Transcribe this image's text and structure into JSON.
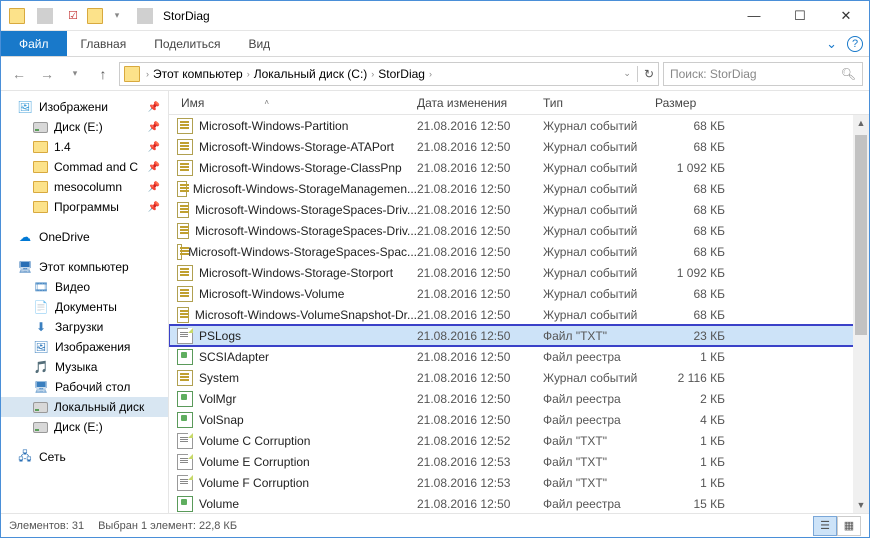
{
  "window": {
    "title": "StorDiag"
  },
  "ribbon": {
    "file": "Файл",
    "tabs": [
      "Главная",
      "Поделиться",
      "Вид"
    ]
  },
  "breadcrumb": {
    "crumbs": [
      "Этот компьютер",
      "Локальный диск (C:)",
      "StorDiag"
    ]
  },
  "search": {
    "placeholder": "Поиск: StorDiag"
  },
  "columns": {
    "name": "Имя",
    "date": "Дата изменения",
    "type": "Тип",
    "size": "Размер"
  },
  "sidebar": {
    "quickaccess_label": "Изображени",
    "pinned": [
      {
        "label": "Диск (E:)",
        "icon": "drive"
      },
      {
        "label": "1.4",
        "icon": "folder"
      },
      {
        "label": "Commad and C",
        "icon": "folder"
      },
      {
        "label": "mesocolumn",
        "icon": "folder"
      },
      {
        "label": "Программы",
        "icon": "folder"
      }
    ],
    "onedrive": "OneDrive",
    "thispc": "Этот компьютер",
    "thispc_items": [
      {
        "label": "Видео"
      },
      {
        "label": "Документы"
      },
      {
        "label": "Загрузки"
      },
      {
        "label": "Изображения"
      },
      {
        "label": "Музыка"
      },
      {
        "label": "Рабочий стол"
      },
      {
        "label": "Локальный диск",
        "selected": true,
        "icon": "drive"
      },
      {
        "label": "Диск (E:)",
        "icon": "drive"
      }
    ],
    "network": "Сеть"
  },
  "files": [
    {
      "name": "Microsoft-Windows-Partition",
      "date": "21.08.2016 12:50",
      "type": "Журнал событий",
      "size": "68 КБ",
      "icon": "evt"
    },
    {
      "name": "Microsoft-Windows-Storage-ATAPort",
      "date": "21.08.2016 12:50",
      "type": "Журнал событий",
      "size": "68 КБ",
      "icon": "evt"
    },
    {
      "name": "Microsoft-Windows-Storage-ClassPnp",
      "date": "21.08.2016 12:50",
      "type": "Журнал событий",
      "size": "1 092 КБ",
      "icon": "evt"
    },
    {
      "name": "Microsoft-Windows-StorageManagemen...",
      "date": "21.08.2016 12:50",
      "type": "Журнал событий",
      "size": "68 КБ",
      "icon": "evt"
    },
    {
      "name": "Microsoft-Windows-StorageSpaces-Driv...",
      "date": "21.08.2016 12:50",
      "type": "Журнал событий",
      "size": "68 КБ",
      "icon": "evt"
    },
    {
      "name": "Microsoft-Windows-StorageSpaces-Driv...",
      "date": "21.08.2016 12:50",
      "type": "Журнал событий",
      "size": "68 КБ",
      "icon": "evt"
    },
    {
      "name": "Microsoft-Windows-StorageSpaces-Spac...",
      "date": "21.08.2016 12:50",
      "type": "Журнал событий",
      "size": "68 КБ",
      "icon": "evt"
    },
    {
      "name": "Microsoft-Windows-Storage-Storport",
      "date": "21.08.2016 12:50",
      "type": "Журнал событий",
      "size": "1 092 КБ",
      "icon": "evt"
    },
    {
      "name": "Microsoft-Windows-Volume",
      "date": "21.08.2016 12:50",
      "type": "Журнал событий",
      "size": "68 КБ",
      "icon": "evt"
    },
    {
      "name": "Microsoft-Windows-VolumeSnapshot-Dr...",
      "date": "21.08.2016 12:50",
      "type": "Журнал событий",
      "size": "68 КБ",
      "icon": "evt"
    },
    {
      "name": "PSLogs",
      "date": "21.08.2016 12:50",
      "type": "Файл \"TXT\"",
      "size": "23 КБ",
      "icon": "txt",
      "highlighted": true
    },
    {
      "name": "SCSIAdapter",
      "date": "21.08.2016 12:50",
      "type": "Файл реестра",
      "size": "1 КБ",
      "icon": "reg"
    },
    {
      "name": "System",
      "date": "21.08.2016 12:50",
      "type": "Журнал событий",
      "size": "2 116 КБ",
      "icon": "evt"
    },
    {
      "name": "VolMgr",
      "date": "21.08.2016 12:50",
      "type": "Файл реестра",
      "size": "2 КБ",
      "icon": "reg"
    },
    {
      "name": "VolSnap",
      "date": "21.08.2016 12:50",
      "type": "Файл реестра",
      "size": "4 КБ",
      "icon": "reg"
    },
    {
      "name": "Volume C Corruption",
      "date": "21.08.2016 12:52",
      "type": "Файл \"TXT\"",
      "size": "1 КБ",
      "icon": "txt"
    },
    {
      "name": "Volume E Corruption",
      "date": "21.08.2016 12:53",
      "type": "Файл \"TXT\"",
      "size": "1 КБ",
      "icon": "txt"
    },
    {
      "name": "Volume F Corruption",
      "date": "21.08.2016 12:53",
      "type": "Файл \"TXT\"",
      "size": "1 КБ",
      "icon": "txt"
    },
    {
      "name": "Volume",
      "date": "21.08.2016 12:50",
      "type": "Файл реестра",
      "size": "15 КБ",
      "icon": "reg"
    }
  ],
  "status": {
    "count": "Элементов: 31",
    "selection": "Выбран 1 элемент: 22,8 КБ"
  }
}
